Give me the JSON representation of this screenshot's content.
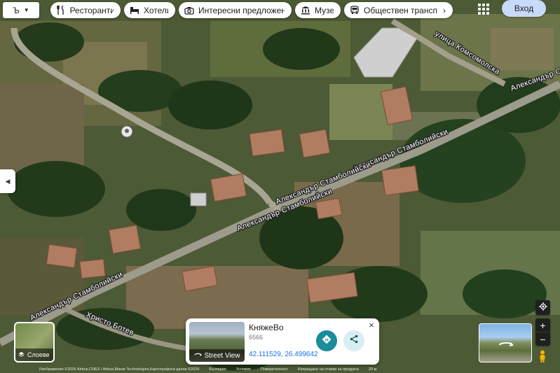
{
  "topbar": {
    "language": "Ъ",
    "chips": [
      {
        "label": "Ресторанти",
        "icon": "fork-knife-icon"
      },
      {
        "label": "Хотели",
        "icon": "bed-icon"
      },
      {
        "label": "Интересни предложения",
        "icon": "camera-icon"
      },
      {
        "label": "Музеи",
        "icon": "museum-icon"
      },
      {
        "label": "Обществен трансп",
        "icon": "bus-icon"
      }
    ],
    "login_label": "Вход",
    "apps_icon": "grid-icon"
  },
  "map": {
    "roads": [
      {
        "name": "Александър Стамболийски"
      },
      {
        "name": "Александър Стамболийски"
      },
      {
        "name": "Александър Стамболийски"
      },
      {
        "name": "Александър Стамболийски"
      },
      {
        "name": "Александър Стамболийски"
      },
      {
        "name": "улица Комсомолска"
      },
      {
        "name": "Христо Ботев"
      }
    ]
  },
  "layers_button": {
    "label": "Слоеве"
  },
  "place_card": {
    "street_view_label": "Street View",
    "title": "КняжеВо",
    "postcode": "6566",
    "coordinates": "42.111529, 26.499642",
    "close_label": "×"
  },
  "controls": {
    "zoom_in": "+",
    "zoom_out": "−"
  },
  "attribution": {
    "items": [
      "Изображения ©2026 Airbus,CNES / Airbus,Maxar Technologies,Картографски данни ©2026",
      "България",
      "Условия",
      "Поверителност",
      "Изпращане на отзиви за продукта",
      "20 м"
    ]
  },
  "colors": {
    "accent": "#1a8c9b",
    "login_bg": "#c8daf9",
    "link": "#1a73e8"
  }
}
